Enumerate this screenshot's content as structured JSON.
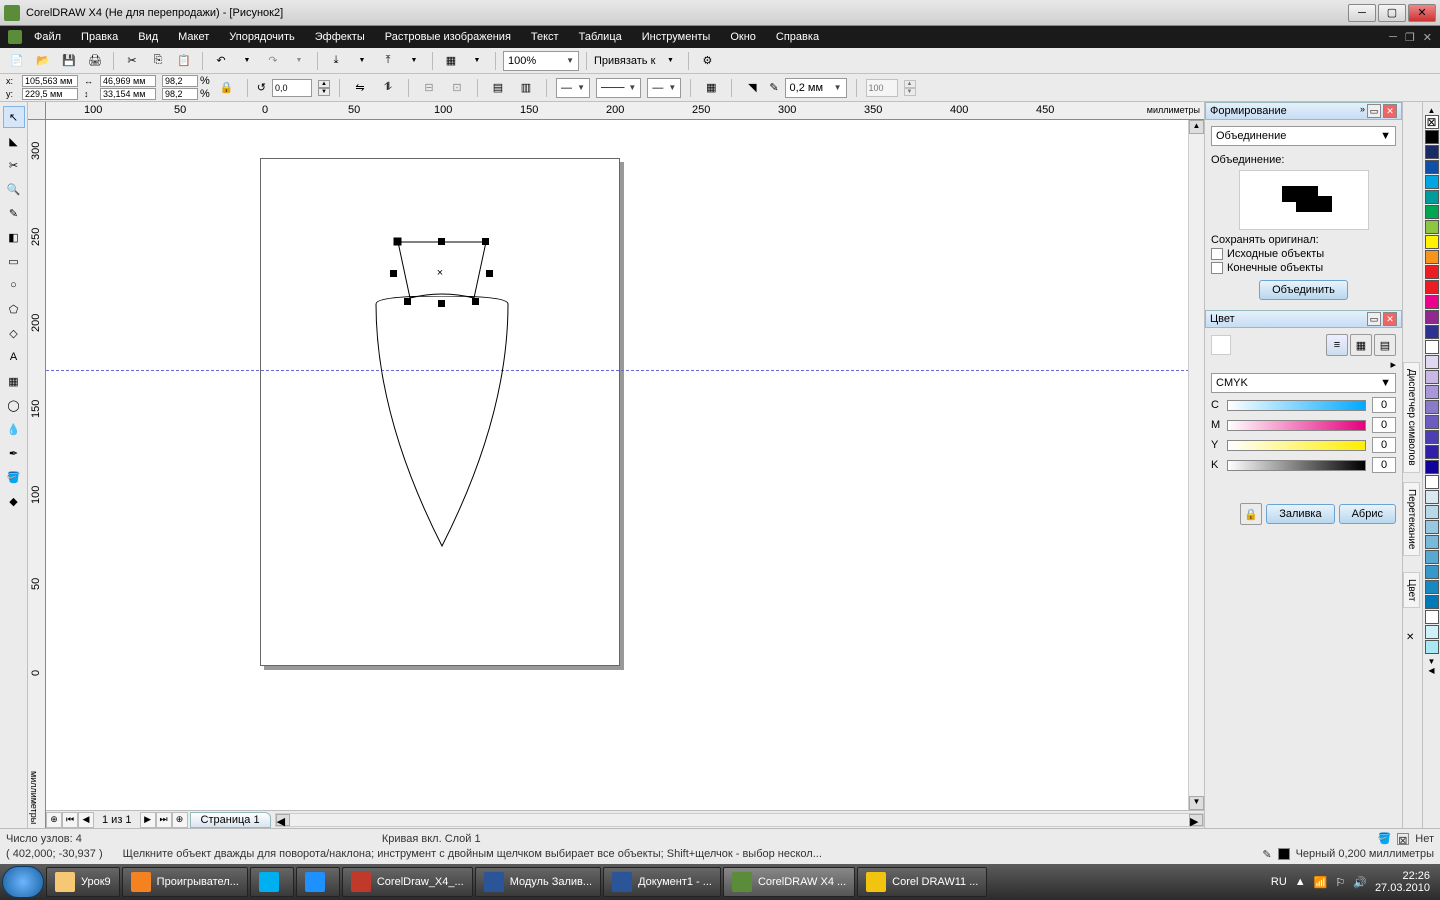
{
  "title": "CorelDRAW X4 (Не для перепродажи) - [Рисунок2]",
  "menu": [
    "Файл",
    "Правка",
    "Вид",
    "Макет",
    "Упорядочить",
    "Эффекты",
    "Растровые изображения",
    "Текст",
    "Таблица",
    "Инструменты",
    "Окно",
    "Справка"
  ],
  "toolbar": {
    "zoom": "100%",
    "snap_label": "Привязать к"
  },
  "property": {
    "x": "105,563 мм",
    "y": "229,5 мм",
    "w": "46,969 мм",
    "h": "33,154 мм",
    "sx": "98,2",
    "sy": "98,2",
    "rot": "0,0",
    "outline_w": "0,2 мм",
    "wrap": "100"
  },
  "ruler": {
    "unit": "миллиметры",
    "ticks": [
      0,
      50,
      100,
      150,
      200,
      250,
      300,
      350,
      400,
      450
    ],
    "vticks": [
      0,
      50,
      100,
      150,
      200,
      250,
      300
    ]
  },
  "shaping": {
    "title": "Формирование",
    "op": "Объединение",
    "op_label": "Объединение:",
    "keep_label": "Сохранять оригинал:",
    "src": "Исходные объекты",
    "tgt": "Конечные объекты",
    "apply": "Объединить"
  },
  "color": {
    "title": "Цвет",
    "model": "CMYK",
    "c": 0,
    "m": 0,
    "y": 0,
    "k": 0,
    "fill_btn": "Заливка",
    "outline_btn": "Абрис"
  },
  "palette_colors": [
    "#ffffff",
    "#000000",
    "#1a2a66",
    "#0f4fa8",
    "#00a6e0",
    "#009b77",
    "#00a651",
    "#8dc63f",
    "#fff200",
    "#f7941e",
    "#ed1c24",
    "#ec008c",
    "#92278f",
    "#5b5b5b",
    "#8a5d3b",
    "#c0c0c0"
  ],
  "page_nav": {
    "range": "1 из 1",
    "tab": "Страница 1"
  },
  "status": {
    "nodes": "Число узлов: 4",
    "curve": "Кривая вкл. Слой 1",
    "coords": "( 402,000; -30,937 )",
    "hint": "Щелкните объект дважды для поворота/наклона; инструмент с двойным щелчком выбирает все объекты; Shift+щелчок - выбор нескол...",
    "fill_none": "Нет",
    "outline": "Черный  0,200 миллиметры"
  },
  "taskbar": {
    "items": [
      {
        "label": "Урок9",
        "color": "#f7c873"
      },
      {
        "label": "Проигрывател...",
        "color": "#f58220"
      },
      {
        "label": "",
        "color": "#00aff0"
      },
      {
        "label": "",
        "color": "#1e90ff"
      },
      {
        "label": "CorelDraw_X4_...",
        "color": "#c0392b"
      },
      {
        "label": "Модуль Залив...",
        "color": "#2a5699"
      },
      {
        "label": "Документ1 - ...",
        "color": "#2a5699"
      },
      {
        "label": "CorelDRAW X4 ...",
        "color": "#5a8c3a",
        "active": true
      },
      {
        "label": "Corel DRAW11 ...",
        "color": "#f1c40f"
      }
    ],
    "lang": "RU",
    "time": "22:26",
    "date": "27.03.2010"
  },
  "vtabs": [
    "Диспетчер символов",
    "Перетекание",
    "Цвет"
  ]
}
